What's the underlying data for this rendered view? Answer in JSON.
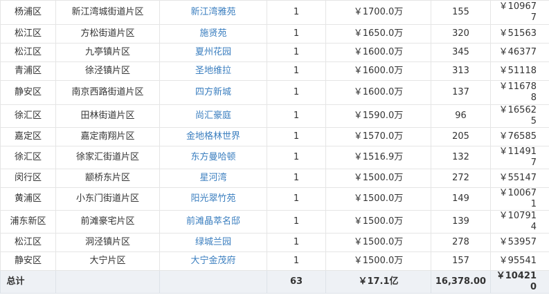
{
  "rows": [
    {
      "district": "杨浦区",
      "area": "新江湾城街道片区",
      "name": "新江湾雅苑",
      "count": "1",
      "price": "￥1700.0万",
      "size": "155",
      "unit_price": "￥109677",
      "tall": true
    },
    {
      "district": "松江区",
      "area": "方松街道片区",
      "name": "施贤苑",
      "count": "1",
      "price": "￥1650.0万",
      "size": "320",
      "unit_price": "￥51563",
      "tall": false
    },
    {
      "district": "松江区",
      "area": "九亭镇片区",
      "name": "夏州花园",
      "count": "1",
      "price": "￥1600.0万",
      "size": "345",
      "unit_price": "￥46377",
      "tall": false
    },
    {
      "district": "青浦区",
      "area": "徐泾镇片区",
      "name": "圣地维拉",
      "count": "1",
      "price": "￥1600.0万",
      "size": "313",
      "unit_price": "￥51118",
      "tall": false
    },
    {
      "district": "静安区",
      "area": "南京西路街道片区",
      "name": "四方新城",
      "count": "1",
      "price": "￥1600.0万",
      "size": "137",
      "unit_price": "￥116788",
      "tall": true
    },
    {
      "district": "徐汇区",
      "area": "田林街道片区",
      "name": "尚汇豪庭",
      "count": "1",
      "price": "￥1590.0万",
      "size": "96",
      "unit_price": "￥165625",
      "tall": false
    },
    {
      "district": "嘉定区",
      "area": "嘉定南翔片区",
      "name": "金地格林世界",
      "count": "1",
      "price": "￥1570.0万",
      "size": "205",
      "unit_price": "￥76585",
      "tall": false
    },
    {
      "district": "徐汇区",
      "area": "徐家汇街道片区",
      "name": "东方曼哈顿",
      "count": "1",
      "price": "￥1516.9万",
      "size": "132",
      "unit_price": "￥114917",
      "tall": false
    },
    {
      "district": "闵行区",
      "area": "颛桥东片区",
      "name": "星河湾",
      "count": "1",
      "price": "￥1500.0万",
      "size": "272",
      "unit_price": "￥55147",
      "tall": false
    },
    {
      "district": "黄浦区",
      "area": "小东门街道片区",
      "name": "阳光翠竹苑",
      "count": "1",
      "price": "￥1500.0万",
      "size": "149",
      "unit_price": "￥100671",
      "tall": false
    },
    {
      "district": "浦东新区",
      "area": "前滩豪宅片区",
      "name": "前滩晶萃名邸",
      "count": "1",
      "price": "￥1500.0万",
      "size": "139",
      "unit_price": "￥107914",
      "tall": false
    },
    {
      "district": "松江区",
      "area": "洞泾镇片区",
      "name": "绿城兰园",
      "count": "1",
      "price": "￥1500.0万",
      "size": "278",
      "unit_price": "￥53957",
      "tall": false
    },
    {
      "district": "静安区",
      "area": "大宁片区",
      "name": "大宁金茂府",
      "count": "1",
      "price": "￥1500.0万",
      "size": "157",
      "unit_price": "￥95541",
      "tall": false
    }
  ],
  "total": {
    "label": "总计",
    "area": "",
    "name": "",
    "count": "63",
    "price": "￥17.1亿",
    "size": "16,378.00",
    "unit_price": "￥104210"
  }
}
